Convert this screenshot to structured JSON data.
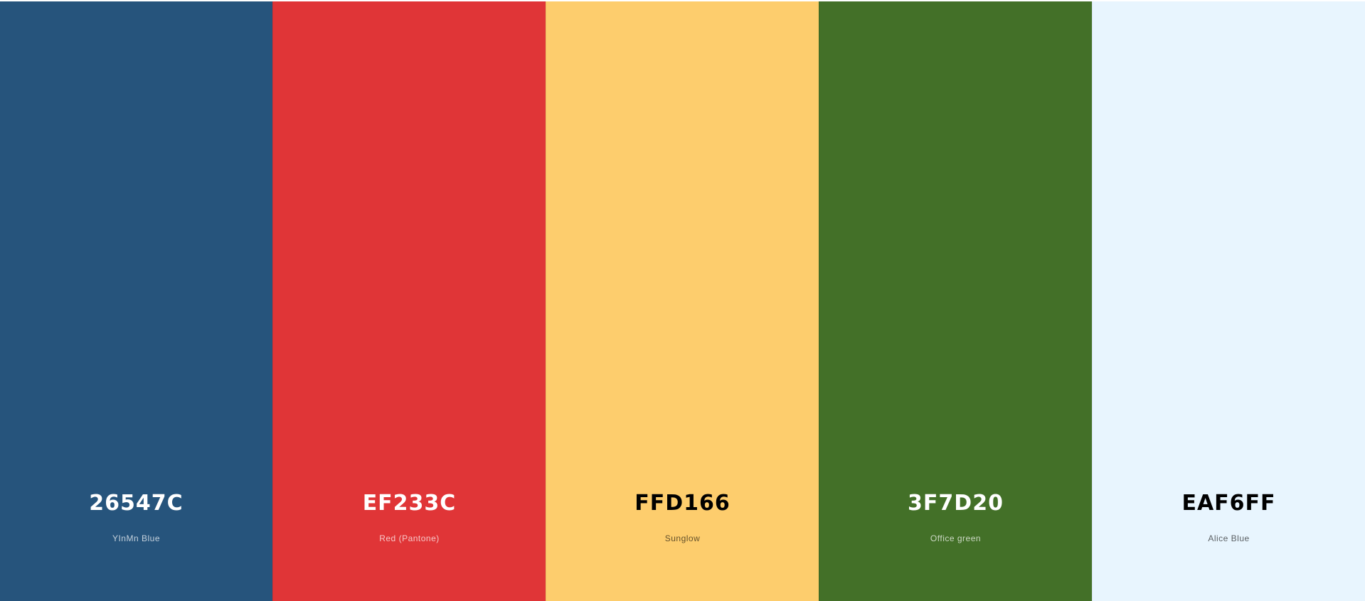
{
  "palette": {
    "colors": [
      {
        "hex": "26547C",
        "name": "YInMn Blue",
        "color": "#26547C"
      },
      {
        "hex": "EF233C",
        "name": "Red (Pantone)",
        "color": "#EF233C"
      },
      {
        "hex": "FFD166",
        "name": "Sunglow",
        "color": "#FFD166"
      },
      {
        "hex": "3F7D20",
        "name": "Office green",
        "color": "#3F7D20"
      },
      {
        "hex": "EAF6FF",
        "name": "Alice Blue",
        "color": "#EAF6FF"
      }
    ]
  }
}
